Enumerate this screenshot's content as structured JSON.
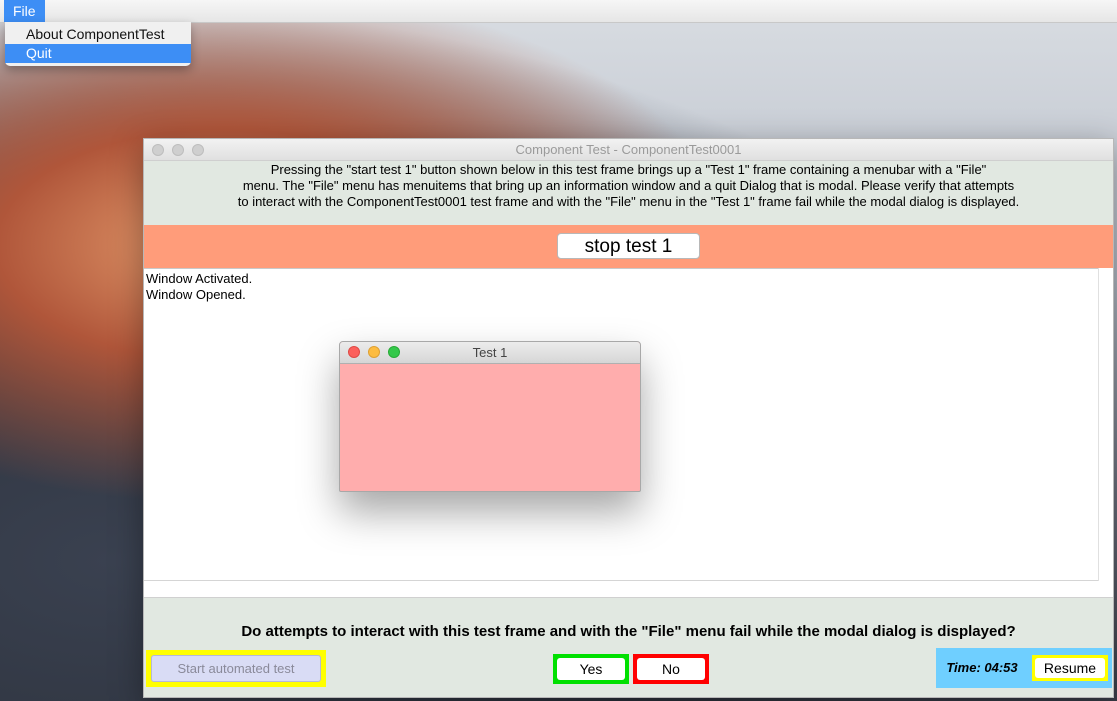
{
  "menubar": {
    "file_label": "File",
    "dropdown": [
      {
        "label": "About ComponentTest"
      },
      {
        "label": "Quit"
      }
    ]
  },
  "main_window": {
    "title": "Component Test - ComponentTest0001",
    "instructions": [
      "Pressing the \"start test 1\" button shown below in this test frame brings up a \"Test 1\" frame containing a menubar with a \"File\"",
      "menu. The \"File\" menu has menuitems that bring up an information window and a quit Dialog that is modal. Please verify that attempts",
      "to interact with the ComponentTest0001 test frame and with the \"File\" menu in the \"Test 1\" frame fail while the modal dialog is displayed."
    ],
    "stop_button": "stop test 1",
    "log": [
      "Window Activated.",
      "Window Opened."
    ],
    "question": "Do attempts to interact with this test frame and with the \"File\" menu fail while the modal dialog is displayed?",
    "auto_button": "Start automated test",
    "yes_button": "Yes",
    "no_button": "No",
    "time": "Time: 04:53",
    "resume_button": "Resume"
  },
  "test_window": {
    "title": "Test 1"
  },
  "colors": {
    "menu_highlight": "#3d8ef5",
    "orange_bar": "#ff9c7a",
    "test_window_bg": "#ffadad",
    "yes_outline": "#00e000",
    "no_outline": "#ff0000",
    "highlight_yellow": "#ffff00",
    "time_bg": "#6fcfff"
  }
}
